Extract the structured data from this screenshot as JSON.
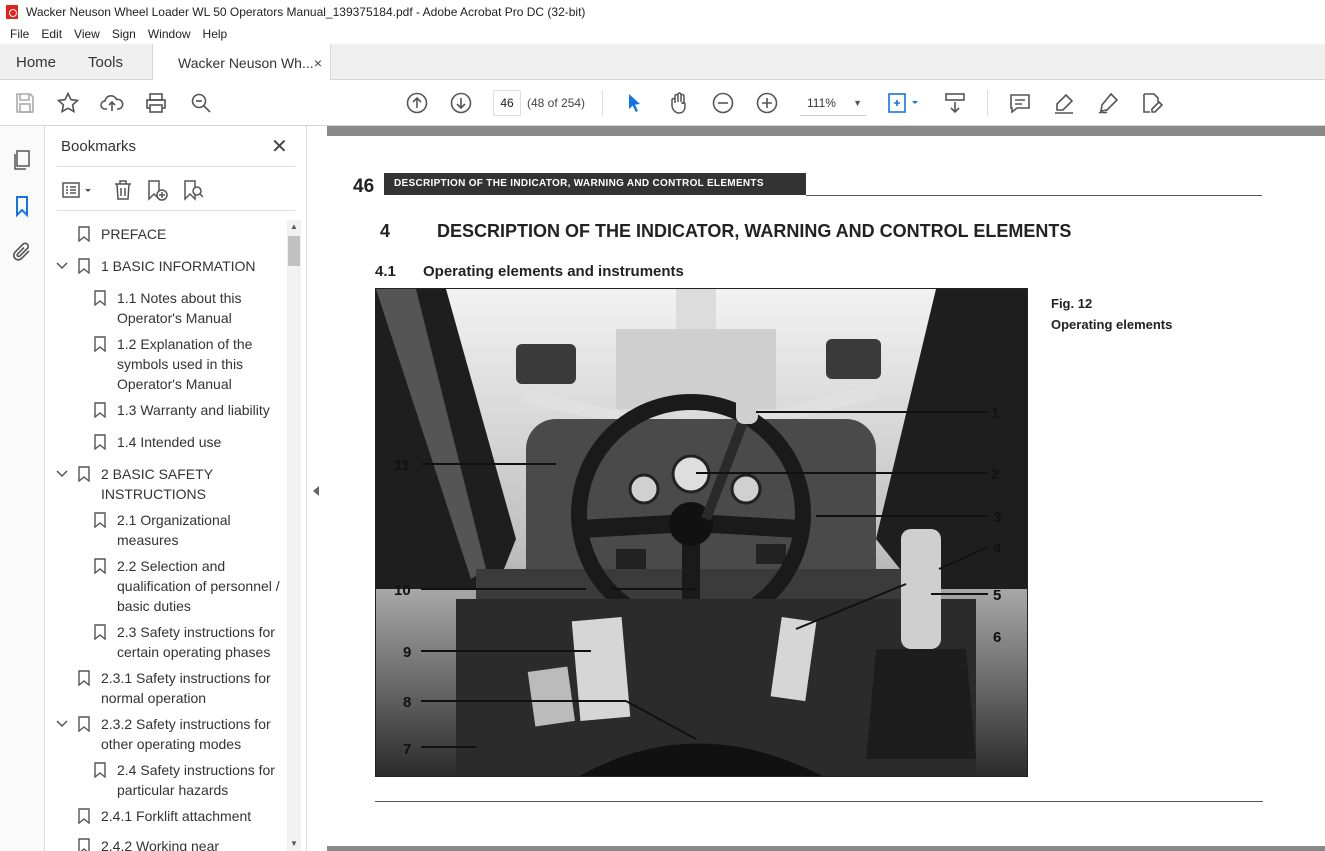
{
  "window": {
    "title": "Wacker Neuson Wheel Loader WL 50 Operators Manual_139375184.pdf - Adobe Acrobat Pro DC (32-bit)"
  },
  "menu": [
    "File",
    "Edit",
    "View",
    "Sign",
    "Window",
    "Help"
  ],
  "tabs": {
    "home": "Home",
    "tools": "Tools",
    "document": "Wacker Neuson Wh...",
    "close": "×"
  },
  "toolbar": {
    "page_value": "46",
    "page_count": "(48 of 254)",
    "zoom": "111%",
    "icons": [
      "save-icon",
      "star-icon",
      "upload-icon",
      "print-icon",
      "find-icon",
      "prev-page-icon",
      "next-page-icon",
      "select-cursor-icon",
      "hand-icon",
      "zoom-out-icon",
      "zoom-in-icon",
      "fit-page-icon",
      "scroll-mode-icon",
      "comment-icon",
      "highlight-icon",
      "sign-icon",
      "edit-icon"
    ],
    "accent": "#1473e6"
  },
  "rail": {
    "icons": [
      "pages-icon",
      "bookmark-icon",
      "attachment-icon"
    ]
  },
  "bookmarks": {
    "title": "Bookmarks",
    "close": "✕",
    "items": [
      {
        "label": "PREFACE"
      },
      {
        "label": "1 BASIC INFORMATION"
      },
      {
        "label": "1.1 Notes about this Operator's Manual"
      },
      {
        "label": "1.2 Explanation of the symbols used in this Operator's Manual"
      },
      {
        "label": "1.3 Warranty and liability"
      },
      {
        "label": "1.4 Intended use"
      },
      {
        "label": "2 BASIC SAFETY INSTRUCTIONS"
      },
      {
        "label": "2.1 Organizational measures"
      },
      {
        "label": "2.2 Selection and qualification of personnel / basic duties"
      },
      {
        "label": "2.3 Safety instructions for certain operating phases"
      },
      {
        "label": "2.3.1 Safety instructions for normal operation"
      },
      {
        "label": "2.3.2 Safety instructions for other operating modes"
      },
      {
        "label": "2.4 Safety instructions for particular hazards"
      },
      {
        "label": "2.4.1 Forklift attachment"
      },
      {
        "label": "2.4.2 Working near"
      }
    ]
  },
  "document": {
    "page_number": "46",
    "header": "DESCRIPTION OF THE INDICATOR, WARNING AND CONTROL ELEMENTS",
    "chapter_number": "4",
    "chapter_title": "DESCRIPTION OF THE INDICATOR, WARNING AND CONTROL ELEMENTS",
    "section_number": "4.1",
    "section_title": "Operating elements and instruments",
    "figure_title": "Fig. 12",
    "figure_subtitle": "Operating elements",
    "callouts": [
      "1",
      "2",
      "3",
      "4",
      "5",
      "6",
      "7",
      "8",
      "9",
      "10",
      "11"
    ]
  }
}
